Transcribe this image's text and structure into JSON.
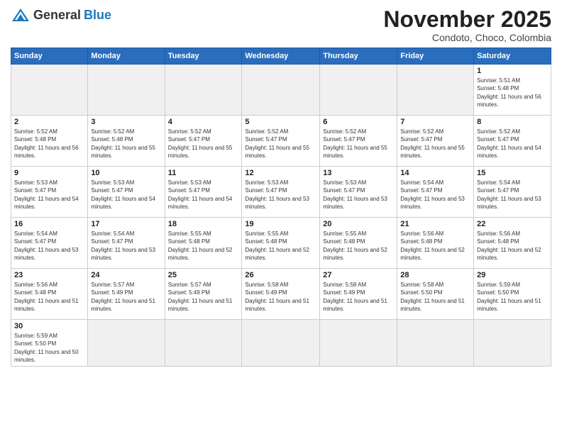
{
  "header": {
    "logo_general": "General",
    "logo_blue": "Blue",
    "title": "November 2025",
    "location": "Condoto, Choco, Colombia"
  },
  "days_of_week": [
    "Sunday",
    "Monday",
    "Tuesday",
    "Wednesday",
    "Thursday",
    "Friday",
    "Saturday"
  ],
  "weeks": [
    [
      {
        "day": "",
        "empty": true
      },
      {
        "day": "",
        "empty": true
      },
      {
        "day": "",
        "empty": true
      },
      {
        "day": "",
        "empty": true
      },
      {
        "day": "",
        "empty": true
      },
      {
        "day": "",
        "empty": true
      },
      {
        "day": "1",
        "sunrise": "Sunrise: 5:51 AM",
        "sunset": "Sunset: 5:48 PM",
        "daylight": "Daylight: 11 hours and 56 minutes."
      }
    ],
    [
      {
        "day": "2",
        "sunrise": "Sunrise: 5:52 AM",
        "sunset": "Sunset: 5:48 PM",
        "daylight": "Daylight: 11 hours and 56 minutes."
      },
      {
        "day": "3",
        "sunrise": "Sunrise: 5:52 AM",
        "sunset": "Sunset: 5:48 PM",
        "daylight": "Daylight: 11 hours and 55 minutes."
      },
      {
        "day": "4",
        "sunrise": "Sunrise: 5:52 AM",
        "sunset": "Sunset: 5:47 PM",
        "daylight": "Daylight: 11 hours and 55 minutes."
      },
      {
        "day": "5",
        "sunrise": "Sunrise: 5:52 AM",
        "sunset": "Sunset: 5:47 PM",
        "daylight": "Daylight: 11 hours and 55 minutes."
      },
      {
        "day": "6",
        "sunrise": "Sunrise: 5:52 AM",
        "sunset": "Sunset: 5:47 PM",
        "daylight": "Daylight: 11 hours and 55 minutes."
      },
      {
        "day": "7",
        "sunrise": "Sunrise: 5:52 AM",
        "sunset": "Sunset: 5:47 PM",
        "daylight": "Daylight: 11 hours and 55 minutes."
      },
      {
        "day": "8",
        "sunrise": "Sunrise: 5:52 AM",
        "sunset": "Sunset: 5:47 PM",
        "daylight": "Daylight: 11 hours and 54 minutes."
      }
    ],
    [
      {
        "day": "9",
        "sunrise": "Sunrise: 5:53 AM",
        "sunset": "Sunset: 5:47 PM",
        "daylight": "Daylight: 11 hours and 54 minutes."
      },
      {
        "day": "10",
        "sunrise": "Sunrise: 5:53 AM",
        "sunset": "Sunset: 5:47 PM",
        "daylight": "Daylight: 11 hours and 54 minutes."
      },
      {
        "day": "11",
        "sunrise": "Sunrise: 5:53 AM",
        "sunset": "Sunset: 5:47 PM",
        "daylight": "Daylight: 11 hours and 54 minutes."
      },
      {
        "day": "12",
        "sunrise": "Sunrise: 5:53 AM",
        "sunset": "Sunset: 5:47 PM",
        "daylight": "Daylight: 11 hours and 53 minutes."
      },
      {
        "day": "13",
        "sunrise": "Sunrise: 5:53 AM",
        "sunset": "Sunset: 5:47 PM",
        "daylight": "Daylight: 11 hours and 53 minutes."
      },
      {
        "day": "14",
        "sunrise": "Sunrise: 5:54 AM",
        "sunset": "Sunset: 5:47 PM",
        "daylight": "Daylight: 11 hours and 53 minutes."
      },
      {
        "day": "15",
        "sunrise": "Sunrise: 5:54 AM",
        "sunset": "Sunset: 5:47 PM",
        "daylight": "Daylight: 11 hours and 53 minutes."
      }
    ],
    [
      {
        "day": "16",
        "sunrise": "Sunrise: 5:54 AM",
        "sunset": "Sunset: 5:47 PM",
        "daylight": "Daylight: 11 hours and 53 minutes."
      },
      {
        "day": "17",
        "sunrise": "Sunrise: 5:54 AM",
        "sunset": "Sunset: 5:47 PM",
        "daylight": "Daylight: 11 hours and 53 minutes."
      },
      {
        "day": "18",
        "sunrise": "Sunrise: 5:55 AM",
        "sunset": "Sunset: 5:48 PM",
        "daylight": "Daylight: 11 hours and 52 minutes."
      },
      {
        "day": "19",
        "sunrise": "Sunrise: 5:55 AM",
        "sunset": "Sunset: 5:48 PM",
        "daylight": "Daylight: 11 hours and 52 minutes."
      },
      {
        "day": "20",
        "sunrise": "Sunrise: 5:55 AM",
        "sunset": "Sunset: 5:48 PM",
        "daylight": "Daylight: 11 hours and 52 minutes."
      },
      {
        "day": "21",
        "sunrise": "Sunrise: 5:56 AM",
        "sunset": "Sunset: 5:48 PM",
        "daylight": "Daylight: 11 hours and 52 minutes."
      },
      {
        "day": "22",
        "sunrise": "Sunrise: 5:56 AM",
        "sunset": "Sunset: 5:48 PM",
        "daylight": "Daylight: 11 hours and 52 minutes."
      }
    ],
    [
      {
        "day": "23",
        "sunrise": "Sunrise: 5:56 AM",
        "sunset": "Sunset: 5:48 PM",
        "daylight": "Daylight: 11 hours and 51 minutes."
      },
      {
        "day": "24",
        "sunrise": "Sunrise: 5:57 AM",
        "sunset": "Sunset: 5:49 PM",
        "daylight": "Daylight: 11 hours and 51 minutes."
      },
      {
        "day": "25",
        "sunrise": "Sunrise: 5:57 AM",
        "sunset": "Sunset: 5:49 PM",
        "daylight": "Daylight: 11 hours and 51 minutes."
      },
      {
        "day": "26",
        "sunrise": "Sunrise: 5:58 AM",
        "sunset": "Sunset: 5:49 PM",
        "daylight": "Daylight: 11 hours and 51 minutes."
      },
      {
        "day": "27",
        "sunrise": "Sunrise: 5:58 AM",
        "sunset": "Sunset: 5:49 PM",
        "daylight": "Daylight: 11 hours and 51 minutes."
      },
      {
        "day": "28",
        "sunrise": "Sunrise: 5:58 AM",
        "sunset": "Sunset: 5:50 PM",
        "daylight": "Daylight: 11 hours and 51 minutes."
      },
      {
        "day": "29",
        "sunrise": "Sunrise: 5:59 AM",
        "sunset": "Sunset: 5:50 PM",
        "daylight": "Daylight: 11 hours and 51 minutes."
      }
    ],
    [
      {
        "day": "30",
        "sunrise": "Sunrise: 5:59 AM",
        "sunset": "Sunset: 5:50 PM",
        "daylight": "Daylight: 11 hours and 50 minutes.",
        "last": true
      },
      {
        "day": "",
        "empty": true,
        "last": true
      },
      {
        "day": "",
        "empty": true,
        "last": true
      },
      {
        "day": "",
        "empty": true,
        "last": true
      },
      {
        "day": "",
        "empty": true,
        "last": true
      },
      {
        "day": "",
        "empty": true,
        "last": true
      },
      {
        "day": "",
        "empty": true,
        "last": true
      }
    ]
  ]
}
